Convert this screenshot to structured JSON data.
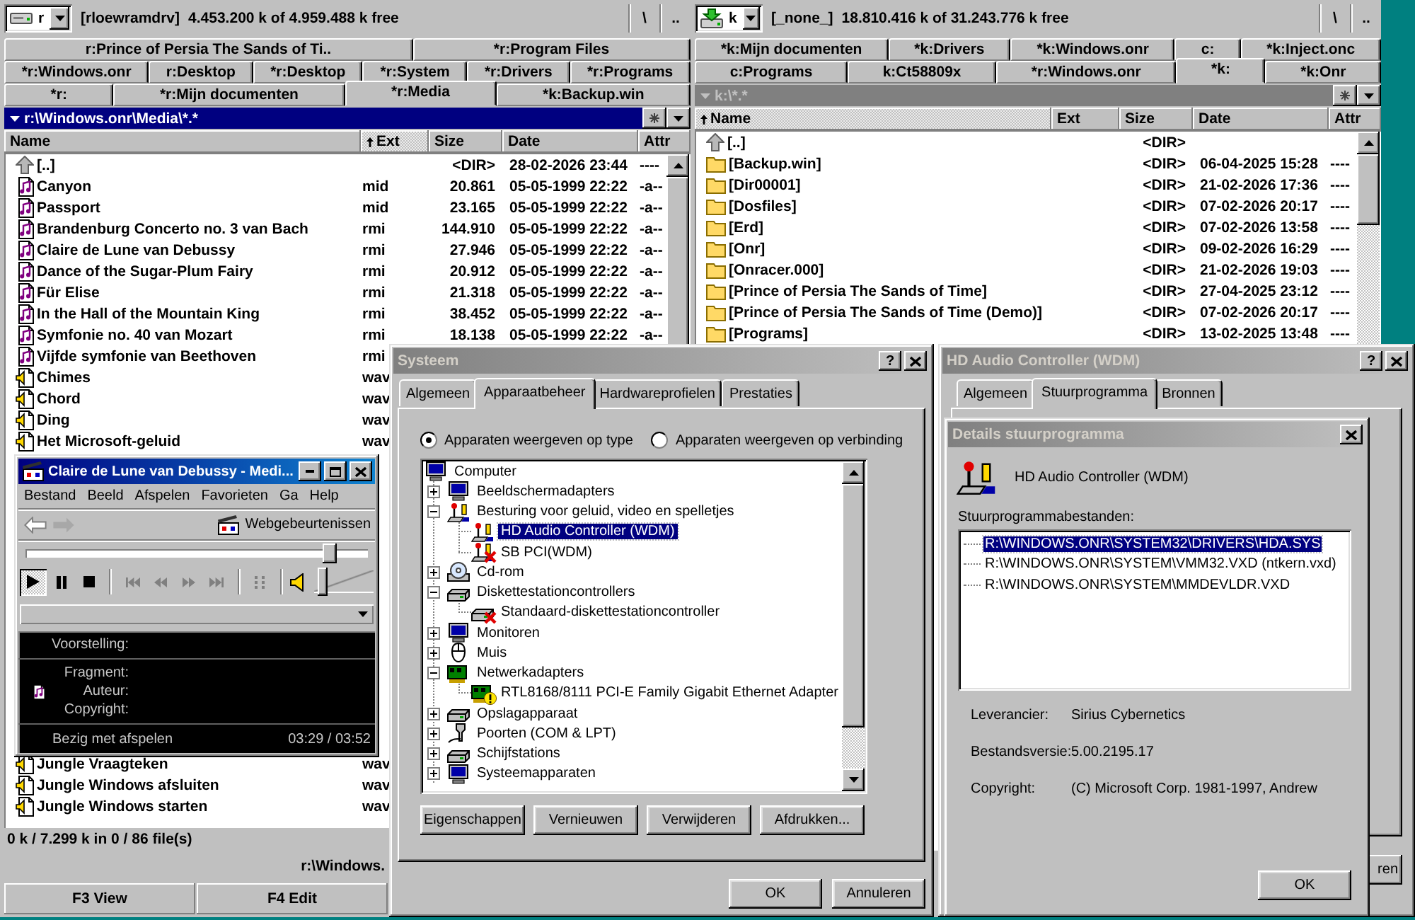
{
  "file_manager": {
    "panels": [
      {
        "drive": {
          "letter": "r",
          "kind": "fixed"
        },
        "volume": "[rloewramdrv]",
        "free_space": "4.453.200 k of 4.959.488 k free",
        "root_button": "\\",
        "parent_button": "..",
        "tab_rows": [
          {
            "tabs": [
              {
                "label": "r:Prince of Persia The Sands of Ti..",
                "selected": false
              },
              {
                "label": "*r:Program Files",
                "selected": false
              }
            ]
          },
          {
            "tabs": [
              {
                "label": "*r:Windows.onr",
                "selected": false
              },
              {
                "label": "r:Desktop",
                "selected": false
              },
              {
                "label": "*r:Desktop",
                "selected": false
              },
              {
                "label": "*r:System",
                "selected": false
              },
              {
                "label": "*r:Drivers",
                "selected": false
              },
              {
                "label": "*r:Programs",
                "selected": false
              }
            ]
          },
          {
            "tabs": [
              {
                "label": "*r:",
                "selected": false
              },
              {
                "label": "*r:Mijn documenten",
                "selected": false
              },
              {
                "label": "*r:Media",
                "selected": true
              },
              {
                "label": "*k:Backup.win",
                "selected": false
              }
            ]
          }
        ],
        "active": true,
        "path": "r:\\Windows.onr\\Media\\*.*",
        "columns": [
          {
            "label": "Name",
            "sorted": false
          },
          {
            "label": "Ext",
            "sorted": true
          },
          {
            "label": "Size",
            "sorted": false
          },
          {
            "label": "Date",
            "sorted": false
          },
          {
            "label": "Attr",
            "sorted": false
          }
        ],
        "row_groups": [
          {
            "rows": [
              {
                "kind": "parent",
                "name": "[..]",
                "size": "<DIR>",
                "date": "28-02-2026 23:44",
                "attr": "----"
              },
              {
                "kind": "midi",
                "name": "Canyon",
                "ext": "mid",
                "size": "20.861",
                "date": "05-05-1999 22:22",
                "attr": "-a--"
              },
              {
                "kind": "midi",
                "name": "Passport",
                "ext": "mid",
                "size": "23.165",
                "date": "05-05-1999 22:22",
                "attr": "-a--"
              },
              {
                "kind": "midi",
                "name": "Brandenburg Concerto no. 3 van Bach",
                "ext": "rmi",
                "size": "144.910",
                "date": "05-05-1999 22:22",
                "attr": "-a--"
              },
              {
                "kind": "midi",
                "name": "Claire de Lune van Debussy",
                "ext": "rmi",
                "size": "27.946",
                "date": "05-05-1999 22:22",
                "attr": "-a--"
              },
              {
                "kind": "midi",
                "name": "Dance of the Sugar-Plum Fairy",
                "ext": "rmi",
                "size": "20.912",
                "date": "05-05-1999 22:22",
                "attr": "-a--"
              },
              {
                "kind": "midi",
                "name": "Für Elise",
                "ext": "rmi",
                "size": "21.318",
                "date": "05-05-1999 22:22",
                "attr": "-a--"
              },
              {
                "kind": "midi",
                "name": "In the Hall of the Mountain King",
                "ext": "rmi",
                "size": "38.452",
                "date": "05-05-1999 22:22",
                "attr": "-a--"
              },
              {
                "kind": "midi",
                "name": "Symfonie no. 40 van Mozart",
                "ext": "rmi",
                "size": "18.138",
                "date": "05-05-1999 22:22",
                "attr": "-a--"
              },
              {
                "kind": "midi",
                "name": "Vijfde symfonie van Beethoven",
                "ext": "rmi"
              },
              {
                "kind": "wave",
                "name": "Chimes",
                "ext": "wav"
              },
              {
                "kind": "wave",
                "name": "Chord",
                "ext": "wav"
              },
              {
                "kind": "wave",
                "name": "Ding",
                "ext": "wav"
              },
              {
                "kind": "wave",
                "name": "Het Microsoft-geluid",
                "ext": "wav"
              }
            ]
          },
          {
            "rows": [
              {
                "kind": "wave",
                "name": "Jungle Vraagteken",
                "ext": "wav"
              },
              {
                "kind": "wave",
                "name": "Jungle Windows afsluiten",
                "ext": "wav"
              },
              {
                "kind": "wave",
                "name": "Jungle Windows starten",
                "ext": "wav"
              }
            ]
          }
        ],
        "status": "0 k / 7.299 k in 0 / 86 file(s)"
      },
      {
        "drive": {
          "letter": "k",
          "kind": "network"
        },
        "volume": "[_none_]",
        "free_space": "18.810.416 k of 31.243.776 k free",
        "root_button": "\\",
        "parent_button": "..",
        "tab_rows": [
          {
            "tabs": [
              {
                "label": "*k:Mijn documenten",
                "selected": false
              },
              {
                "label": "*k:Drivers",
                "selected": false
              },
              {
                "label": "*k:Windows.onr",
                "selected": false
              },
              {
                "label": "c:",
                "selected": false
              },
              {
                "label": "*k:Inject.onc",
                "selected": false
              }
            ]
          },
          {
            "tabs": [
              {
                "label": "c:Programs",
                "selected": false
              },
              {
                "label": "k:Ct58809x",
                "selected": false
              },
              {
                "label": "*r:Windows.onr",
                "selected": false
              },
              {
                "label": "*k:",
                "selected": true
              },
              {
                "label": "*k:Onr",
                "selected": false
              }
            ]
          }
        ],
        "active": false,
        "path": "k:\\*.*",
        "columns": [
          {
            "label": "Name",
            "sorted": true
          },
          {
            "label": "Ext",
            "sorted": false
          },
          {
            "label": "Size",
            "sorted": false
          },
          {
            "label": "Date",
            "sorted": false
          },
          {
            "label": "Attr",
            "sorted": false
          }
        ],
        "row_groups": [
          {
            "rows": [
              {
                "kind": "parent",
                "name": "[..]",
                "size": "<DIR>"
              },
              {
                "kind": "folder",
                "name": "[Backup.win]",
                "size": "<DIR>",
                "date": "06-04-2025 15:28",
                "attr": "----"
              },
              {
                "kind": "folder",
                "name": "[Dir00001]",
                "size": "<DIR>",
                "date": "21-02-2026 17:36",
                "attr": "----"
              },
              {
                "kind": "folder",
                "name": "[Dosfiles]",
                "size": "<DIR>",
                "date": "07-02-2026 20:17",
                "attr": "----"
              },
              {
                "kind": "folder",
                "name": "[Erd]",
                "size": "<DIR>",
                "date": "07-02-2026 13:58",
                "attr": "----"
              },
              {
                "kind": "folder",
                "name": "[Onr]",
                "size": "<DIR>",
                "date": "09-02-2026 16:29",
                "attr": "----"
              },
              {
                "kind": "folder",
                "name": "[Onracer.000]",
                "size": "<DIR>",
                "date": "21-02-2026 19:03",
                "attr": "----"
              },
              {
                "kind": "folder",
                "name": "[Prince of Persia The Sands of Time]",
                "size": "<DIR>",
                "date": "27-04-2025 23:12",
                "attr": "----"
              },
              {
                "kind": "folder",
                "name": "[Prince of Persia The Sands of Time (Demo)]",
                "size": "<DIR>",
                "date": "07-02-2026 20:17",
                "attr": "----"
              },
              {
                "kind": "folder",
                "name": "[Programs]",
                "size": "<DIR>",
                "date": "13-02-2025 13:48",
                "attr": "----"
              }
            ]
          }
        ]
      }
    ],
    "command_path": "r:\\Windows.",
    "function_keys": [
      "F3 View",
      "F4 Edit"
    ]
  },
  "media_player": {
    "title": "Claire de Lune van Debussy - Medi...",
    "active": true,
    "menu": [
      "Bestand",
      "Beeld",
      "Afspelen",
      "Favorieten",
      "Ga",
      "Help"
    ],
    "web_events": "Webgebeurtenissen",
    "seek": {
      "level": 0.89
    },
    "transport_groups": [
      {
        "buttons": [
          {
            "kind": "play",
            "pressed": true,
            "disabled": false
          },
          {
            "kind": "pause",
            "pressed": false,
            "disabled": false
          },
          {
            "kind": "stop",
            "pressed": false,
            "disabled": false
          }
        ]
      },
      {
        "buttons": [
          {
            "kind": "previous",
            "pressed": false,
            "disabled": true
          },
          {
            "kind": "rewind",
            "pressed": false,
            "disabled": true
          },
          {
            "kind": "forward",
            "pressed": false,
            "disabled": true
          },
          {
            "kind": "next",
            "pressed": false,
            "disabled": true
          }
        ]
      },
      {
        "buttons": [
          {
            "kind": "playlist",
            "pressed": false,
            "disabled": true
          }
        ]
      }
    ],
    "volume": {
      "level": 0.14
    },
    "info": {
      "show_label": "Voorstelling:",
      "clip_labels": [
        "Fragment:",
        "Auteur:",
        "Copyright:"
      ],
      "status": "Bezig met afspelen",
      "time": "03:29 / 03:52"
    }
  },
  "system_dialog": {
    "title": "Systeem",
    "active": false,
    "help_button": "?",
    "tabs": [
      {
        "label": "Algemeen",
        "selected": false
      },
      {
        "label": "Apparaatbeheer",
        "selected": true
      },
      {
        "label": "Hardwareprofielen",
        "selected": false
      },
      {
        "label": "Prestaties",
        "selected": false
      }
    ],
    "view_options": [
      {
        "label": "Apparaten weergeven op type",
        "selected": true
      },
      {
        "label": "Apparaten weergeven op verbinding",
        "selected": false
      }
    ],
    "devices": [
      {
        "label": "Computer",
        "kind": "computer",
        "selected": false,
        "disabled": false,
        "problem": false,
        "children": [
          {
            "label": "Beeldschermadapters",
            "kind": "display",
            "selected": false,
            "disabled": false,
            "problem": false,
            "expanded": false
          },
          {
            "label": "Besturing voor geluid, video en spelletjes",
            "kind": "sound",
            "selected": false,
            "disabled": false,
            "problem": false,
            "expanded": true,
            "children": [
              {
                "label": "HD Audio Controller (WDM)",
                "kind": "sound",
                "selected": true,
                "disabled": false,
                "problem": false
              },
              {
                "label": "SB PCI(WDM)",
                "kind": "sound",
                "selected": false,
                "disabled": true,
                "problem": false
              }
            ]
          },
          {
            "label": "Cd-rom",
            "kind": "cdrom",
            "selected": false,
            "disabled": false,
            "problem": false,
            "expanded": false
          },
          {
            "label": "Diskettestationcontrollers",
            "kind": "floppy",
            "selected": false,
            "disabled": false,
            "problem": false,
            "expanded": true,
            "children": [
              {
                "label": "Standaard-diskettestationcontroller",
                "kind": "floppy",
                "selected": false,
                "disabled": true,
                "problem": false
              }
            ]
          },
          {
            "label": "Monitoren",
            "kind": "monitor",
            "selected": false,
            "disabled": false,
            "problem": false,
            "expanded": false
          },
          {
            "label": "Muis",
            "kind": "mouse",
            "selected": false,
            "disabled": false,
            "problem": false,
            "expanded": false
          },
          {
            "label": "Netwerkadapters",
            "kind": "network",
            "selected": false,
            "disabled": false,
            "problem": false,
            "expanded": true,
            "children": [
              {
                "label": "RTL8168/8111 PCI-E Family Gigabit Ethernet Adapter",
                "kind": "network",
                "selected": false,
                "disabled": false,
                "problem": true
              }
            ]
          },
          {
            "label": "Opslagapparaat",
            "kind": "storage",
            "selected": false,
            "disabled": false,
            "problem": false,
            "expanded": false
          },
          {
            "label": "Poorten (COM & LPT)",
            "kind": "port",
            "selected": false,
            "disabled": false,
            "problem": false,
            "expanded": false
          },
          {
            "label": "Schijfstations",
            "kind": "drive",
            "selected": false,
            "disabled": false,
            "problem": false,
            "expanded": false
          },
          {
            "label": "Systeemapparaten",
            "kind": "system",
            "selected": false,
            "disabled": false,
            "problem": false,
            "expanded": false
          }
        ]
      }
    ],
    "buttons": [
      "Eigenschappen",
      "Vernieuwen",
      "Verwijderen",
      "Afdrukken..."
    ],
    "footer_buttons": [
      "OK",
      "Annuleren"
    ]
  },
  "device_dialog": {
    "title": "HD Audio Controller (WDM)",
    "active": false,
    "help_button": "?",
    "tabs": [
      {
        "label": "Algemeen",
        "selected": false
      },
      {
        "label": "Stuurprogramma",
        "selected": true
      },
      {
        "label": "Bronnen",
        "selected": false
      }
    ],
    "partial_button": "ren",
    "details": {
      "title": "Details stuurprogramma",
      "active": false,
      "device_name": "HD Audio Controller (WDM)",
      "files_label": "Stuurprogrammabestanden:",
      "files": [
        {
          "path": "R:\\WINDOWS.ONR\\SYSTEM32\\DRIVERS\\HDA.SYS",
          "selected": true
        },
        {
          "path": "R:\\WINDOWS.ONR\\SYSTEM\\VMM32.VXD (ntkern.vxd)",
          "selected": false
        },
        {
          "path": "R:\\WINDOWS.ONR\\SYSTEM\\MMDEVLDR.VXD",
          "selected": false
        }
      ],
      "properties": [
        {
          "label": "Leverancier:",
          "value": "Sirius Cybernetics"
        },
        {
          "label": "Bestandsversie:",
          "value": "5.00.2195.17"
        },
        {
          "label": "Copyright:",
          "value": "(C) Microsoft Corp. 1981-1997, Andrew"
        }
      ],
      "ok_button": "OK"
    }
  }
}
